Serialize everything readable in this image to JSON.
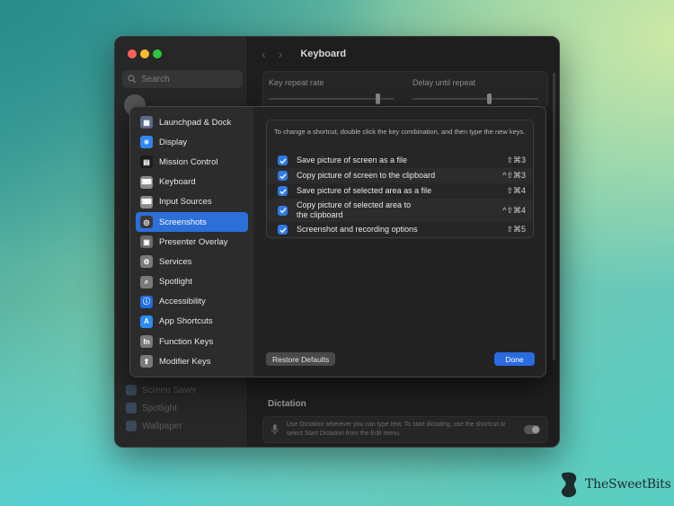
{
  "window": {
    "title": "Keyboard",
    "search_placeholder": "Search",
    "background_sidebar": [
      "Screen Saver",
      "Spotlight",
      "Wallpaper"
    ],
    "key_repeat_label": "Key repeat rate",
    "delay_label": "Delay until repeat",
    "dictation_title": "Dictation",
    "dictation_text": "Use Dictation wherever you can type text. To start dictating, use the shortcut or select Start Dictation from the Edit menu."
  },
  "sheet": {
    "sidebar": [
      {
        "label": "Launchpad & Dock",
        "icon": "launchpad-icon",
        "color": "#5a6b85"
      },
      {
        "label": "Display",
        "icon": "display-icon",
        "color": "#2f86f0"
      },
      {
        "label": "Mission Control",
        "icon": "mission-control-icon",
        "color": "#1b1b1b"
      },
      {
        "label": "Keyboard",
        "icon": "keyboard-icon",
        "color": "#8a8a8a"
      },
      {
        "label": "Input Sources",
        "icon": "input-sources-icon",
        "color": "#8a8a8a"
      },
      {
        "label": "Screenshots",
        "icon": "screenshots-icon",
        "color": "#3a3a3a",
        "active": true
      },
      {
        "label": "Presenter Overlay",
        "icon": "presenter-overlay-icon",
        "color": "#6a6a6a"
      },
      {
        "label": "Services",
        "icon": "gear-icon",
        "color": "#7a7a7a"
      },
      {
        "label": "Spotlight",
        "icon": "spotlight-icon",
        "color": "#7a7a7a"
      },
      {
        "label": "Accessibility",
        "icon": "accessibility-icon",
        "color": "#1f6fe0"
      },
      {
        "label": "App Shortcuts",
        "icon": "app-store-icon",
        "color": "#2b8cf0"
      },
      {
        "label": "Function Keys",
        "icon": "fn-key-icon",
        "color": "#7a7a7a"
      },
      {
        "label": "Modifier Keys",
        "icon": "up-arrow-icon",
        "color": "#7a7a7a"
      }
    ],
    "instructions": "To change a shortcut, double click the key combination, and then type the new keys.",
    "shortcuts": [
      {
        "label": "Save picture of screen as a file",
        "keys": "⇧⌘3",
        "checked": true
      },
      {
        "label": "Copy picture of screen to the clipboard",
        "keys": "^⇧⌘3",
        "checked": true
      },
      {
        "label": "Save picture of selected area as a file",
        "keys": "⇧⌘4",
        "checked": true
      },
      {
        "label": "Copy picture of selected area to\nthe clipboard",
        "keys": "^⇧⌘4",
        "checked": true
      },
      {
        "label": "Screenshot and recording options",
        "keys": "⇧⌘5",
        "checked": true
      }
    ],
    "restore_label": "Restore Defaults",
    "done_label": "Done"
  },
  "brand": {
    "name": "TheSweetBits"
  }
}
